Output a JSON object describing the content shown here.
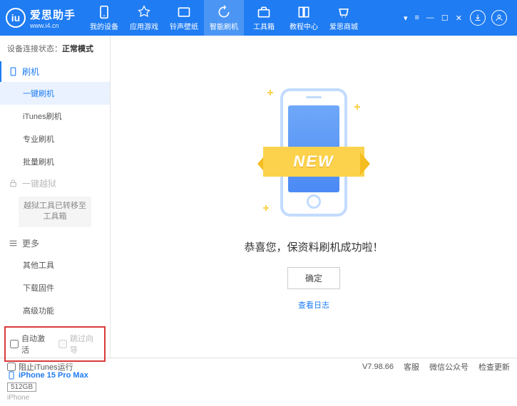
{
  "app": {
    "title": "爱思助手",
    "url": "www.i4.cn"
  },
  "nav": [
    {
      "label": "我的设备"
    },
    {
      "label": "应用游戏"
    },
    {
      "label": "铃声壁纸"
    },
    {
      "label": "智能刷机"
    },
    {
      "label": "工具箱"
    },
    {
      "label": "教程中心"
    },
    {
      "label": "爱思商城"
    }
  ],
  "status": {
    "label": "设备连接状态：",
    "value": "正常模式"
  },
  "sidebar": {
    "flash": {
      "title": "刷机",
      "items": [
        "一键刷机",
        "iTunes刷机",
        "专业刷机",
        "批量刷机"
      ]
    },
    "jailbreak": {
      "title": "一键越狱",
      "note": "越狱工具已转移至\n工具箱"
    },
    "more": {
      "title": "更多",
      "items": [
        "其他工具",
        "下载固件",
        "高级功能"
      ]
    }
  },
  "checks": {
    "auto_activate": "自动激活",
    "skip_guide": "跳过向导"
  },
  "device": {
    "name": "iPhone 15 Pro Max",
    "storage": "512GB",
    "type": "iPhone"
  },
  "main": {
    "ribbon": "NEW",
    "success": "恭喜您，保资料刷机成功啦！",
    "ok": "确定",
    "log": "查看日志"
  },
  "footer": {
    "block_itunes": "阻止iTunes运行",
    "version": "V7.98.66",
    "service": "客服",
    "wechat": "微信公众号",
    "update": "检查更新"
  }
}
